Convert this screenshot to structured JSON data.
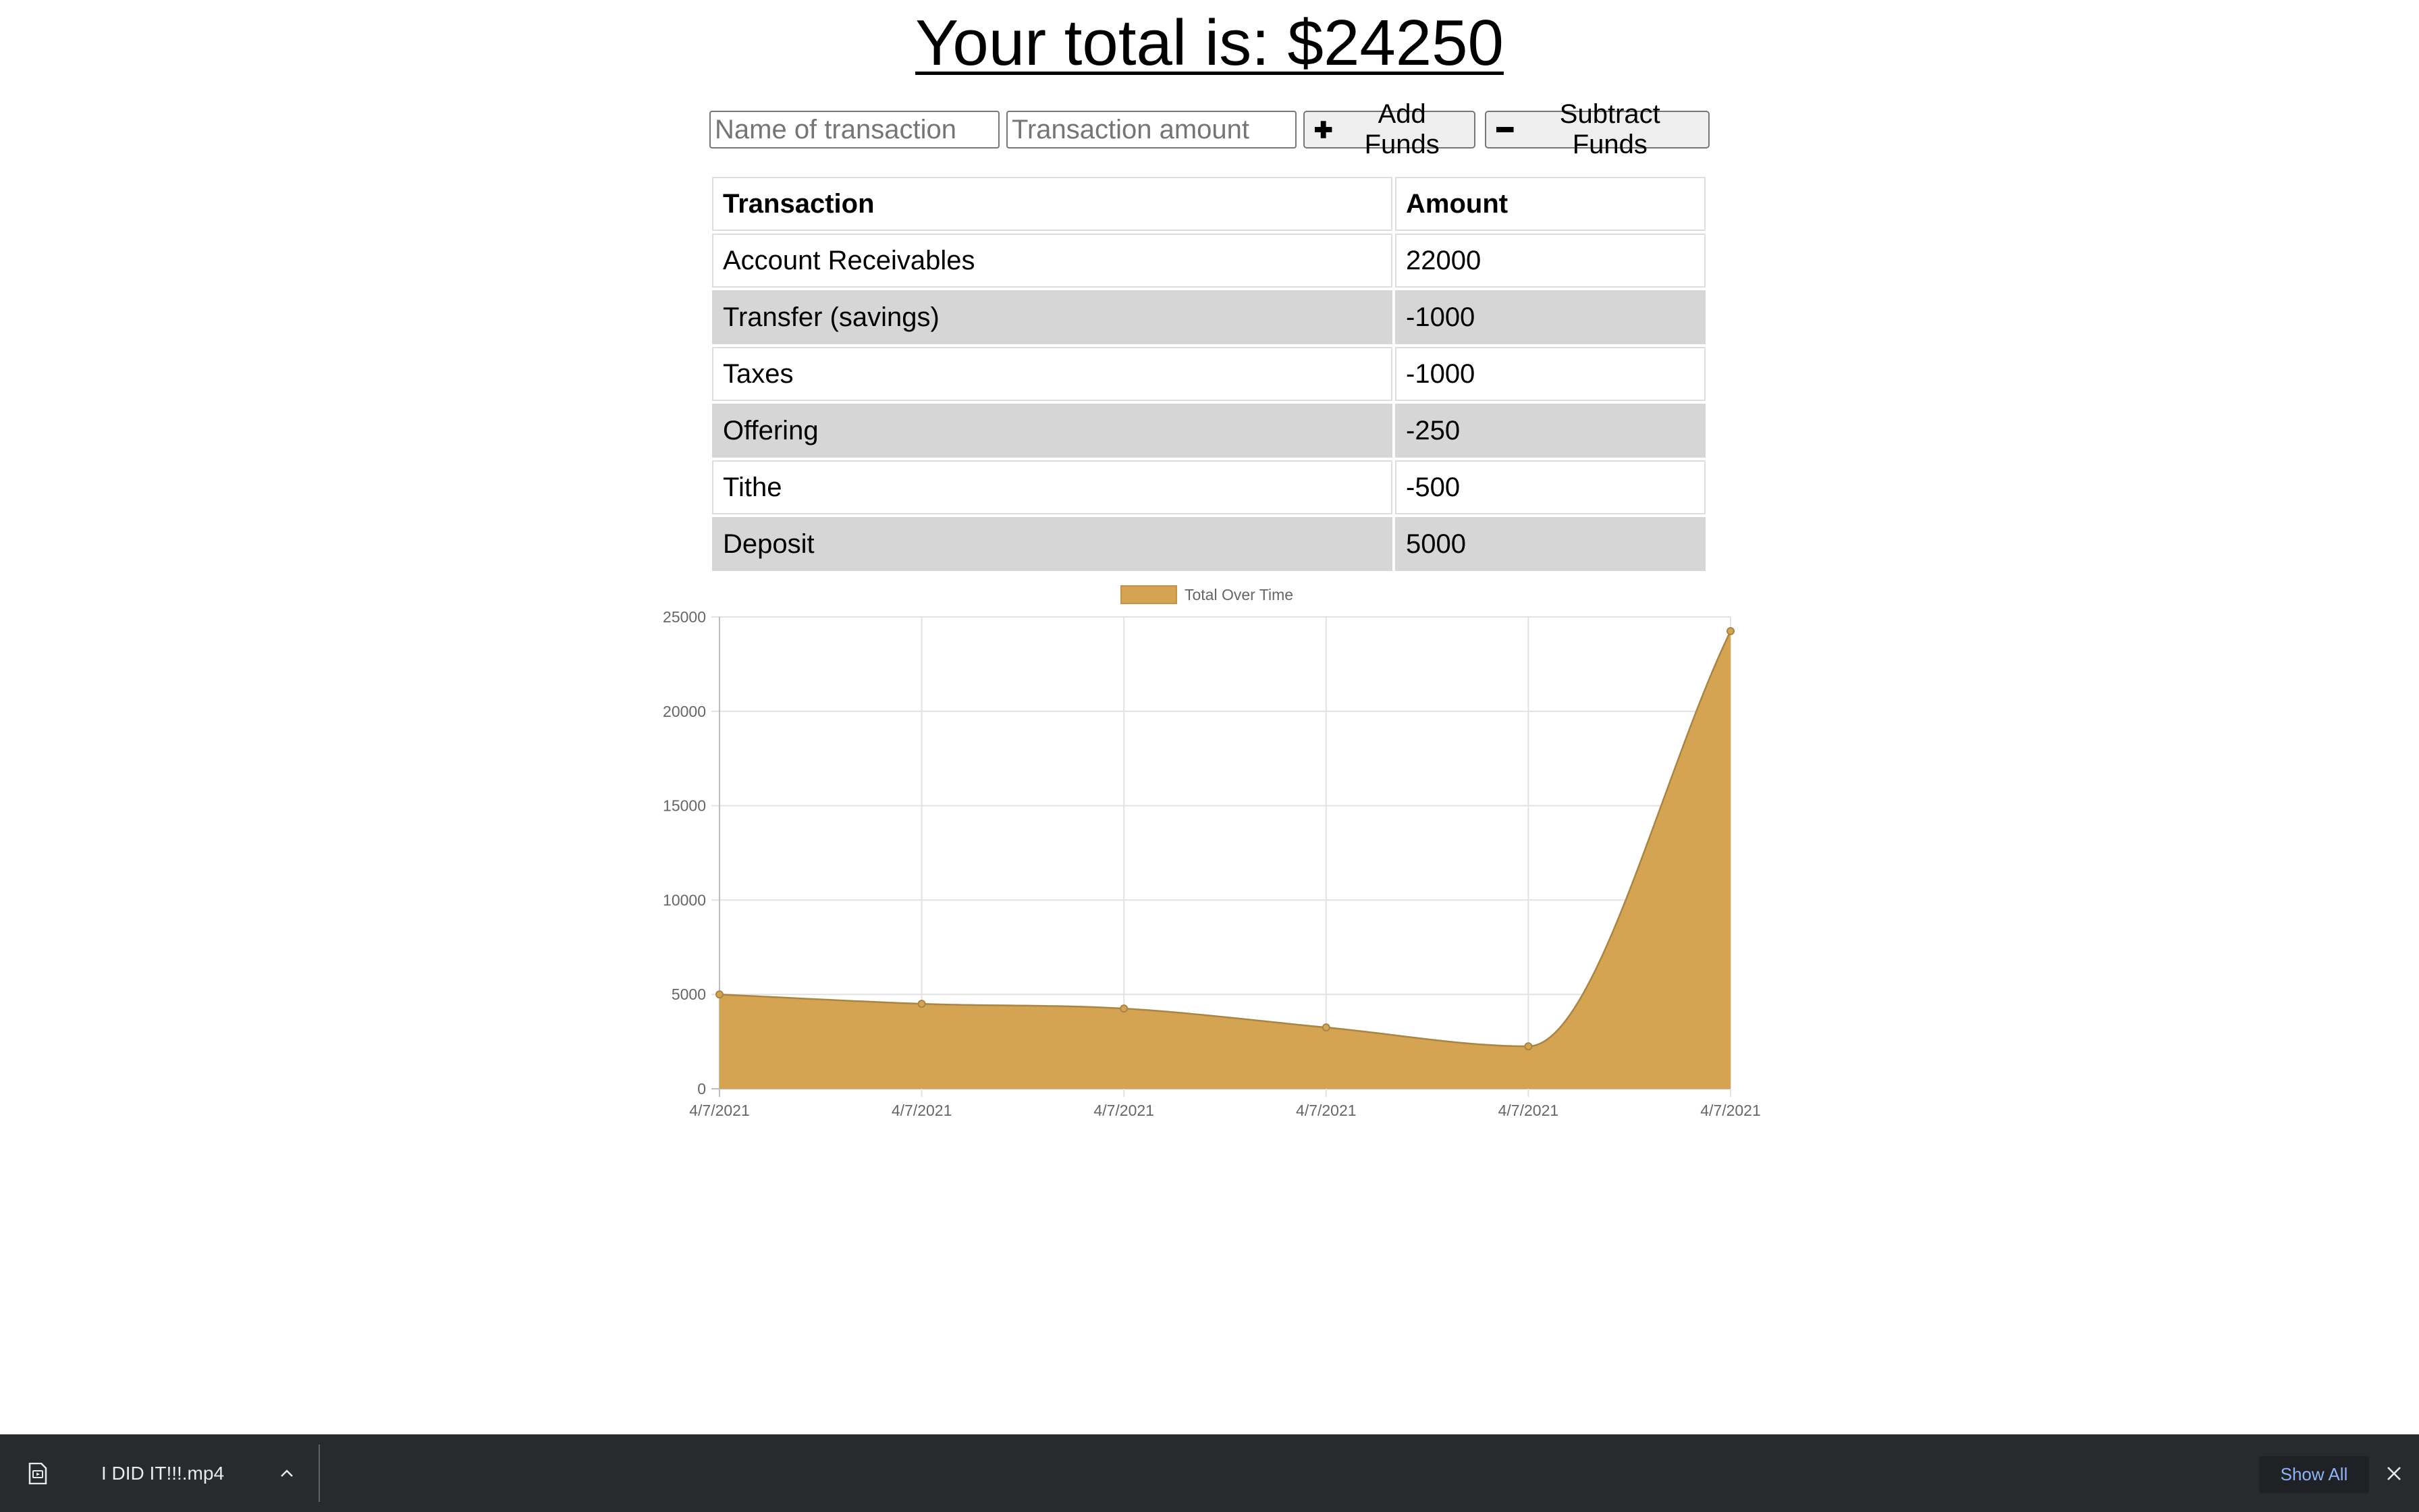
{
  "header": {
    "total_text": "Your total is: $24250"
  },
  "form": {
    "name_placeholder": "Name of transaction",
    "amount_placeholder": "Transaction amount",
    "add_label": "Add Funds",
    "add_icon": "plus-icon",
    "subtract_label": "Subtract Funds",
    "subtract_icon": "minus-icon"
  },
  "table": {
    "headers": [
      "Transaction",
      "Amount"
    ],
    "rows": [
      {
        "name": "Account Receivables",
        "amount": "22000"
      },
      {
        "name": "Transfer (savings)",
        "amount": "-1000"
      },
      {
        "name": "Taxes",
        "amount": "-1000"
      },
      {
        "name": "Offering",
        "amount": "-250"
      },
      {
        "name": "Tithe",
        "amount": "-500"
      },
      {
        "name": "Deposit",
        "amount": "5000"
      }
    ]
  },
  "chart_data": {
    "type": "area",
    "legend": "top",
    "grid": true,
    "x": [
      "4/7/2021",
      "4/7/2021",
      "4/7/2021",
      "4/7/2021",
      "4/7/2021",
      "4/7/2021"
    ],
    "series": [
      {
        "name": "Total Over Time",
        "values": [
          5000,
          4500,
          4250,
          3250,
          2250,
          24250
        ],
        "color": "#d4a453"
      }
    ],
    "ylim": [
      0,
      25000
    ],
    "yticks": [
      0,
      5000,
      10000,
      15000,
      20000,
      25000
    ]
  },
  "download_bar": {
    "file_name": "I DID IT!!!.mp4",
    "file_icon": "video-file-icon",
    "show_all_label": "Show All",
    "close_icon": "close-icon"
  }
}
